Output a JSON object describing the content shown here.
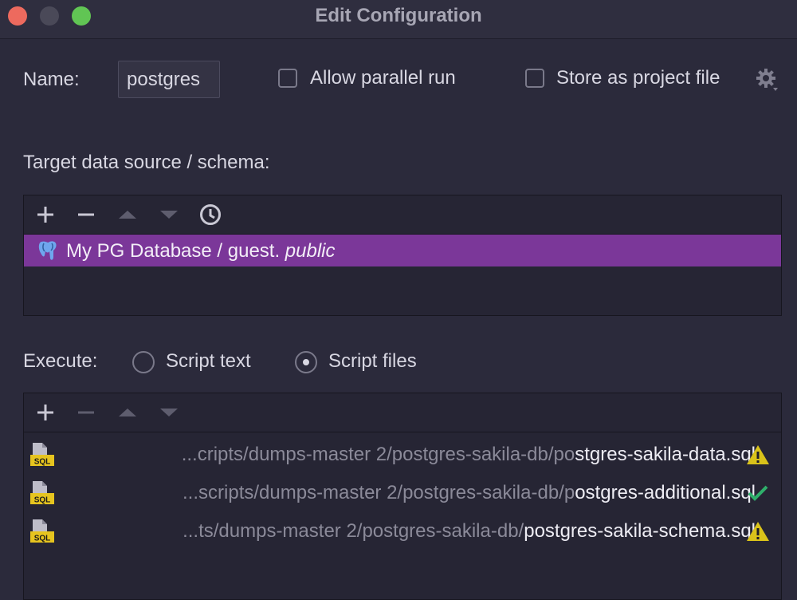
{
  "window": {
    "title": "Edit Configuration"
  },
  "name": {
    "label": "Name:",
    "value": "postgres"
  },
  "options": {
    "allow_parallel": "Allow parallel run",
    "store_project": "Store as project file"
  },
  "target": {
    "label": "Target data source / schema:",
    "item": {
      "name": "My PG Database / guest.",
      "schema": "public"
    }
  },
  "execute": {
    "label": "Execute:",
    "script_text": "Script text",
    "script_files": "Script files",
    "selected": "Script files"
  },
  "files": [
    {
      "prefix": "...cripts/dumps-master 2/postgres-sakila-db/po",
      "name": "stgres-sakila-data.sql",
      "status": "warning"
    },
    {
      "prefix": "...scripts/dumps-master 2/postgres-sakila-db/p",
      "name": "ostgres-additional.sql",
      "status": "ok"
    },
    {
      "prefix": "...ts/dumps-master 2/postgres-sakila-db/",
      "name": "postgres-sakila-schema.sql",
      "status": "warning"
    }
  ],
  "colors": {
    "selection": "#7b3799",
    "warning": "#d9c21a",
    "ok": "#2fb06b",
    "background": "#2b2a3b"
  },
  "icons": [
    "close-icon",
    "minimize-icon",
    "maximize-icon",
    "gear-icon",
    "plus-icon",
    "minus-icon",
    "arrow-up-icon",
    "arrow-down-icon",
    "history-icon",
    "postgres-icon",
    "sql-file-icon",
    "warning-icon",
    "check-icon"
  ]
}
